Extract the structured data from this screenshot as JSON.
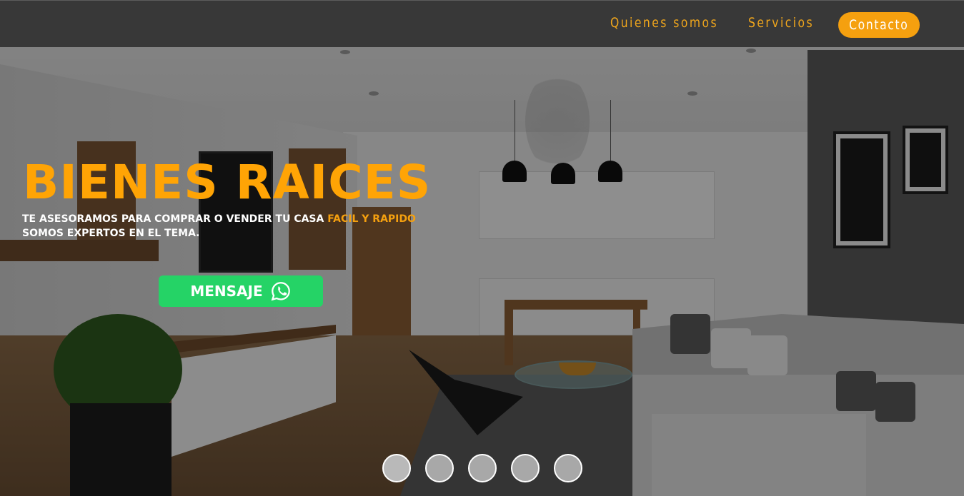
{
  "nav": {
    "items": [
      {
        "label": "Quienes somos"
      },
      {
        "label": "Servicios"
      }
    ],
    "contact_label": "Contacto"
  },
  "hero": {
    "title": "BIENES RAICES",
    "subtitle_part1": "TE ASESORAMOS PARA COMPRAR O VENDER TU CASA ",
    "subtitle_highlight": "FACIL Y RAPIDO",
    "subtitle_part2": " SOMOS EXPERTOS EN EL TEMA.",
    "button_label": "MENSAJE",
    "button_icon": "whatsapp-icon"
  },
  "slider": {
    "dots": 5,
    "active_index": 0
  },
  "colors": {
    "accent": "#f5a00f",
    "title": "#ffa405",
    "whatsapp": "#25d366"
  }
}
